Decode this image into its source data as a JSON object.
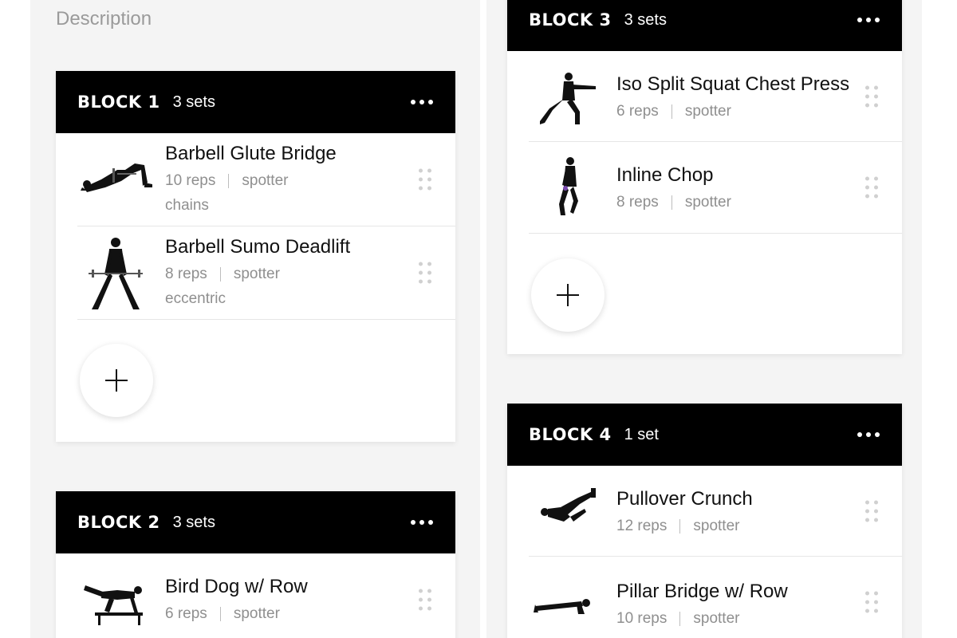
{
  "description_label": "Description",
  "colors": {
    "header_bg": "#000000",
    "panel_bg": "#f4f4f4",
    "meta_text": "#8f8f8f"
  },
  "blocks": [
    {
      "name": "BLOCK 1",
      "sets": "3 sets",
      "exercises": [
        {
          "name": "Barbell Glute Bridge",
          "reps": "10 reps",
          "tag": "spotter",
          "extra": "chains",
          "icon": "glute-bridge-figure-icon"
        },
        {
          "name": "Barbell Sumo Deadlift",
          "reps": "8 reps",
          "tag": "spotter",
          "extra": "eccentric",
          "icon": "sumo-deadlift-figure-icon"
        }
      ]
    },
    {
      "name": "BLOCK 2",
      "sets": "3 sets",
      "exercises": [
        {
          "name": "Bird Dog w/ Row",
          "reps": "6 reps",
          "tag": "spotter",
          "icon": "bird-dog-figure-icon"
        }
      ]
    },
    {
      "name": "BLOCK 3",
      "sets": "3 sets",
      "exercises": [
        {
          "name": "Iso Split Squat Chest Press",
          "reps": "6 reps",
          "tag": "spotter",
          "icon": "split-squat-figure-icon"
        },
        {
          "name": "Inline Chop",
          "reps": "8 reps",
          "tag": "spotter",
          "icon": "inline-chop-figure-icon"
        }
      ]
    },
    {
      "name": "BLOCK 4",
      "sets": "1 set",
      "exercises": [
        {
          "name": "Pullover Crunch",
          "reps": "12 reps",
          "tag": "spotter",
          "icon": "pullover-crunch-figure-icon"
        },
        {
          "name": "Pillar Bridge w/ Row",
          "reps": "10 reps",
          "tag": "spotter",
          "icon": "pillar-bridge-figure-icon"
        }
      ]
    }
  ],
  "icons": {
    "more": "more-dots-icon",
    "drag": "drag-handle-icon",
    "add": "plus-icon"
  }
}
